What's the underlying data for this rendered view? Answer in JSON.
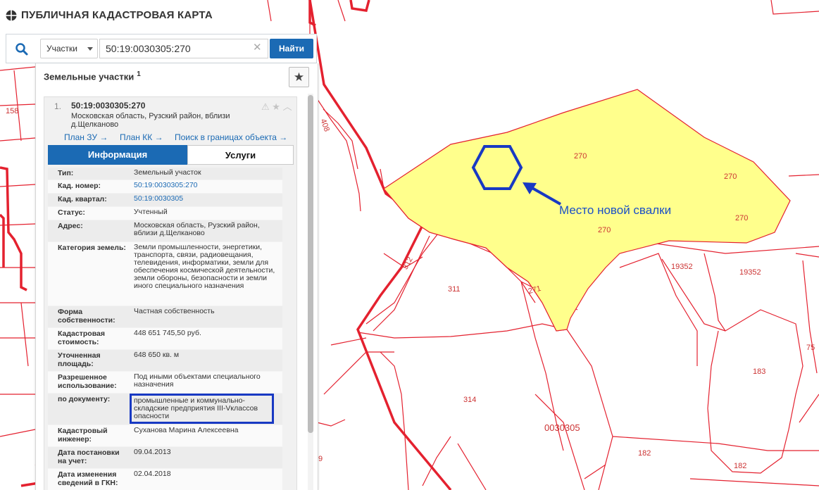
{
  "app": {
    "title": "ПУБЛИЧНАЯ КАДАСТРОВАЯ КАРТА"
  },
  "search": {
    "type_label": "Участки",
    "query": "50:19:0030305:270",
    "button_label": "Найти"
  },
  "panel": {
    "title": "Земельные участки",
    "count": "1",
    "item": {
      "num": "1.",
      "number": "50:19:0030305:270",
      "address": "Московская область, Рузский район, вблизи д.Щелканово",
      "links": [
        "План ЗУ →",
        "План КК →",
        "Поиск в границах объекта →"
      ]
    },
    "tabs": {
      "info": "Информация",
      "services": "Услуги"
    },
    "properties": [
      {
        "label": "Тип:",
        "value": "Земельный участок"
      },
      {
        "label": "Кад. номер:",
        "value": "50:19:0030305:270",
        "link": true
      },
      {
        "label": "Кад. квартал:",
        "value": "50:19:0030305",
        "link": true
      },
      {
        "label": "Статус:",
        "value": "Учтенный"
      },
      {
        "label": "Адрес:",
        "value": "Московская область, Рузский район, вблизи д.Щелканово"
      },
      {
        "label": "Категория земель:",
        "value": "Земли промышленности, энергетики, транспорта, связи, радиовещания, телевидения, информатики, земли для обеспечения космической деятельности, земли обороны, безопасности и земли иного специального назначения"
      },
      {
        "label": "Форма собственности:",
        "value": "Частная собственность"
      },
      {
        "label": "Кадастровая стоимость:",
        "value": "448 651 745,50 руб."
      },
      {
        "label": "Уточненная площадь:",
        "value": "648 650 кв. м"
      },
      {
        "label": "Разрешенное использование:",
        "value": "Под иными объектами специального назначения"
      },
      {
        "label": "по документу:",
        "value": "промышленные и коммунально-складские предприятия III-Vклассов опасности",
        "highlight": true
      },
      {
        "label": "Кадастровый инженер:",
        "value": "Суханова Марина Алексеевна"
      },
      {
        "label": "Дата постановки на учет:",
        "value": "09.04.2013"
      },
      {
        "label": "Дата изменения сведений в ГКН:",
        "value": "02.04.2018"
      }
    ]
  },
  "map": {
    "annotation": "Место новой свалки",
    "labels": {
      "l158": "158",
      "l270a": "270",
      "l270b": "270",
      "l270c": "270",
      "l270d": "270",
      "l408": "408",
      "l312": "312",
      "l311": "311",
      "l271": "271",
      "l19352a": "19352",
      "l19352b": "19352",
      "l75": "75",
      "l183": "183",
      "l314": "314",
      "lquarter": "0030305",
      "l182a": "182",
      "l182b": "182",
      "l9": "9"
    },
    "colors": {
      "parcel_line": "#e4212f",
      "highlight_fill": "#ffff8c",
      "marker": "#1839c3"
    }
  }
}
